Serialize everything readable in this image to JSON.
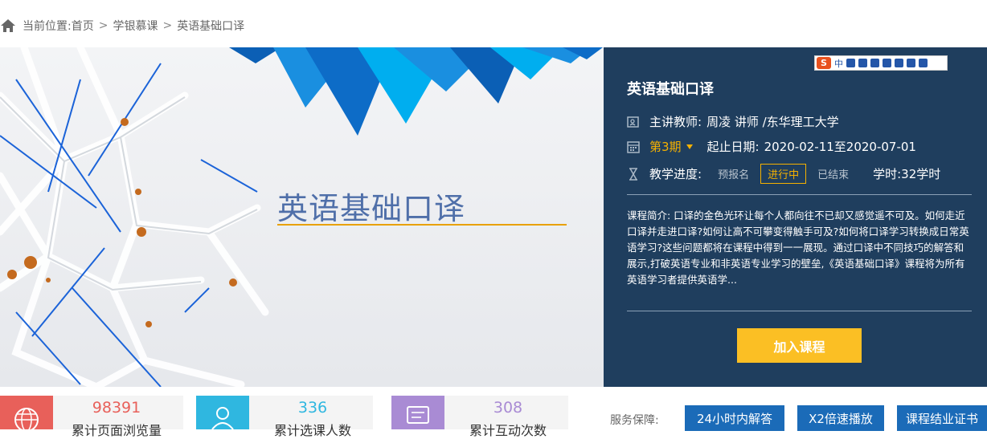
{
  "breadcrumb": {
    "prefix": "当前位置:",
    "items": [
      "首页",
      "学银慕课",
      "英语基础口译"
    ],
    "separator": ">"
  },
  "banner": {
    "title": "英语基础口译",
    "accent_color": "#e8a100"
  },
  "course": {
    "title": "英语基础口译",
    "teacher_label": "主讲教师:",
    "teacher": "周凌 讲师 /东华理工大学",
    "term": "第3期",
    "date_label": "起止日期:",
    "dates": "2020-02-11至2020-07-01",
    "progress_label": "教学进度:",
    "status": [
      "预报名",
      "进行中",
      "已结束"
    ],
    "active_status": "进行中",
    "hours": "学时:32学时",
    "intro": "课程简介: 口译的金色光环让每个人都向往不已却又感觉遥不可及。如何走近口译并走进口译?如何让高不可攀变得触手可及?如何将口译学习转换成日常英语学习?这些问题都将在课程中得到一一展现。通过口译中不同技巧的解答和展示,打破英语专业和非英语专业学习的壁垒,《英语基础口译》课程将为所有英语学习者提供英语学...",
    "join_button": "加入课程",
    "panel_color": "#1f3e5e",
    "button_color": "#fbbf24"
  },
  "ime_toolbar": {
    "logo": "S",
    "mode": "中"
  },
  "stats": [
    {
      "value": "98391",
      "label": "累计页面浏览量",
      "icon": "globe-icon",
      "color": "#e8605a"
    },
    {
      "value": "336",
      "label": "累计选课人数",
      "icon": "users-icon",
      "color": "#2fb7e0"
    },
    {
      "value": "308",
      "label": "累计互动次数",
      "icon": "chat-icon",
      "color": "#a98bd4"
    }
  ],
  "guarantee": {
    "label": "服务保障:",
    "items": [
      "24小时内解答",
      "X2倍速播放",
      "课程结业证书"
    ],
    "color": "#1b6bb8"
  }
}
